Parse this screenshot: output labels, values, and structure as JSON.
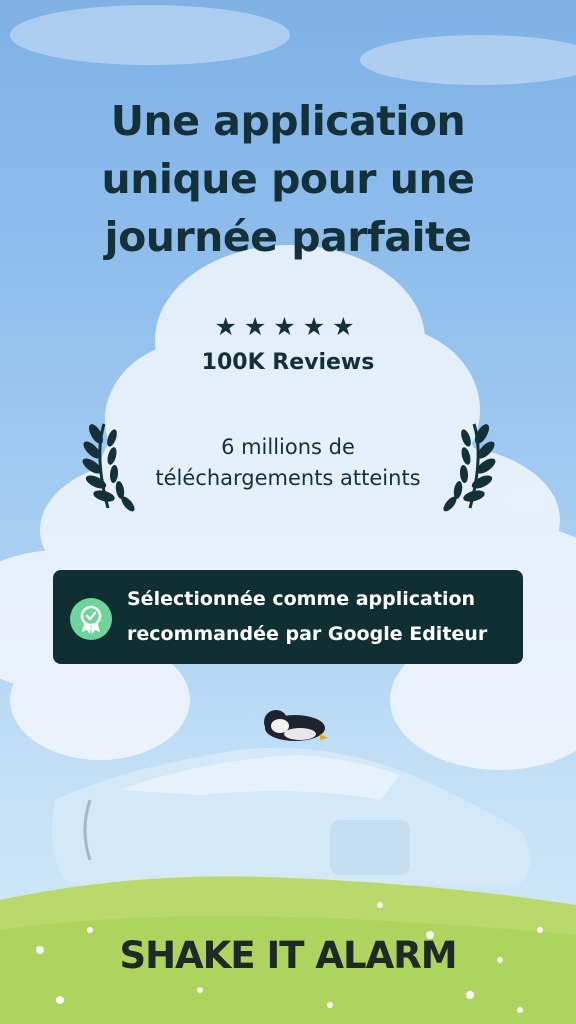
{
  "headline": "Une application\nunique pour une\njournée parfaite",
  "rating": {
    "stars": "★★★★★",
    "star_count": 5,
    "reviews": "100K Reviews"
  },
  "downloads": "6 millions de\ntéléchargements atteints",
  "recommendation": {
    "text": "Sélectionnée comme application\nrecommandée par Google Editeur",
    "icon": "award-check-icon"
  },
  "brand": "SHAKE IT ALARM",
  "colors": {
    "text_dark": "#14313a",
    "badge_bg": "#0f2f33",
    "badge_icon": "#6fd49b",
    "grass": "#b9d96a",
    "sky": "#92c0ee"
  },
  "icons": [
    "laurel-left-icon",
    "laurel-right-icon",
    "award-check-icon",
    "penguin-illustration",
    "cloud-illustration",
    "car-illustration"
  ]
}
